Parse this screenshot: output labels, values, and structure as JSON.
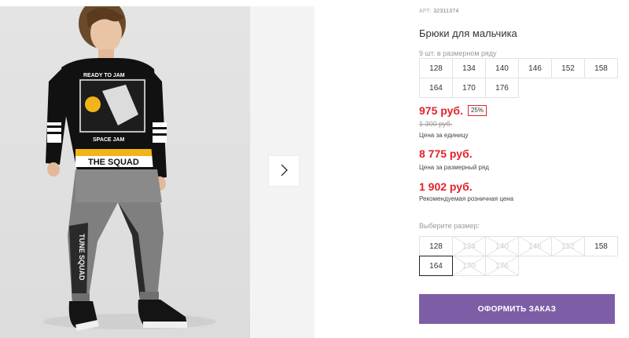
{
  "product": {
    "sku_label": "АРТ:",
    "sku": "32311374",
    "title": "Брюки для мальчика",
    "row_note": "9 шт. в размерном ряду",
    "row_sizes": [
      "128",
      "134",
      "140",
      "146",
      "152",
      "158",
      "164",
      "170",
      "176"
    ],
    "price": "975 руб.",
    "discount": "25%",
    "old_price": "1 300 руб.",
    "price_caption": "Цена за единицу",
    "row_price": "8 775 руб.",
    "row_price_caption": "Цена за размерный ряд",
    "rrp": "1 902 руб.",
    "rrp_caption": "Рекомендуемая розничная цена",
    "choose_label": "Выберите размер:",
    "select_sizes": [
      {
        "label": "128",
        "available": true,
        "selected": false
      },
      {
        "label": "134",
        "available": false,
        "selected": false
      },
      {
        "label": "140",
        "available": false,
        "selected": false
      },
      {
        "label": "146",
        "available": false,
        "selected": false
      },
      {
        "label": "152",
        "available": false,
        "selected": false
      },
      {
        "label": "158",
        "available": true,
        "selected": false
      },
      {
        "label": "164",
        "available": true,
        "selected": true
      },
      {
        "label": "170",
        "available": false,
        "selected": false
      },
      {
        "label": "176",
        "available": false,
        "selected": false
      }
    ],
    "order_button": "ОФОРМИТЬ ЗАКАЗ"
  },
  "gallery": {
    "next_icon": "chevron-right-icon",
    "shirt_text_top": "READY TO JAM",
    "shirt_text_band": "THE SQUAD",
    "shirt_logo": "SPACE JAM",
    "pants_text": "TUNE SQUAD"
  },
  "colors": {
    "accent": "#7d5ea6",
    "price": "#e4212b",
    "border": "#e2e2e2"
  }
}
